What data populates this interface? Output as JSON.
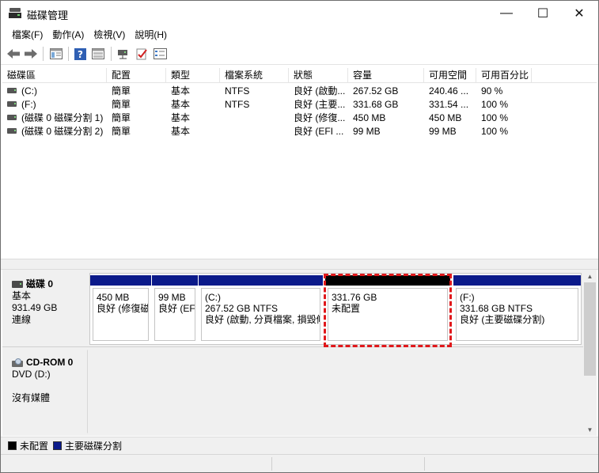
{
  "window": {
    "title": "磁碟管理",
    "minimize": "—",
    "maximize": "☐",
    "close": "✕"
  },
  "menu": [
    "檔案(F)",
    "動作(A)",
    "檢視(V)",
    "說明(H)"
  ],
  "toolbar": {
    "icons": [
      "back-arrow-icon",
      "forward-arrow-icon",
      "properties-grid-icon",
      "help-icon",
      "view-pane-icon",
      "connect-icon",
      "check-icon",
      "settings-list-icon"
    ]
  },
  "table": {
    "headers": [
      "磁碟區",
      "配置",
      "類型",
      "檔案系統",
      "狀態",
      "容量",
      "可用空間",
      "可用百分比"
    ],
    "rows": [
      [
        "(C:)",
        "簡單",
        "基本",
        "NTFS",
        "良好 (啟動...",
        "267.52 GB",
        "240.46 ...",
        "90 %"
      ],
      [
        "(F:)",
        "簡單",
        "基本",
        "NTFS",
        "良好 (主要...",
        "331.68 GB",
        "331.54 ...",
        "100 %"
      ],
      [
        "(磁碟 0 磁碟分割 1)",
        "簡單",
        "基本",
        "",
        "良好 (修復...",
        "450 MB",
        "450 MB",
        "100 %"
      ],
      [
        "(磁碟 0 磁碟分割 2)",
        "簡單",
        "基本",
        "",
        "良好 (EFI ...",
        "99 MB",
        "99 MB",
        "100 %"
      ]
    ]
  },
  "disk0": {
    "name": "磁碟 0",
    "type": "基本",
    "size": "931.49 GB",
    "status": "連線",
    "partitions": [
      {
        "line1": "",
        "line2": "450 MB",
        "line3": "良好 (修復磁",
        "bar": "primary"
      },
      {
        "line1": "",
        "line2": "99 MB",
        "line3": "良好 (EF",
        "bar": "primary"
      },
      {
        "line1": "(C:)",
        "line2": "267.52 GB NTFS",
        "line3": "良好 (啟動, 分頁檔案, 損毀傾",
        "bar": "primary"
      },
      {
        "line1": "",
        "line2": "331.76 GB",
        "line3": "未配置",
        "bar": "unallocated"
      },
      {
        "line1": "(F:)",
        "line2": "331.68 GB NTFS",
        "line3": "良好 (主要磁碟分割)",
        "bar": "primary"
      }
    ]
  },
  "cdrom0": {
    "name": "CD-ROM 0",
    "type": "DVD (D:)",
    "status": "沒有媒體"
  },
  "legend": {
    "unallocated": "未配置",
    "primary": "主要磁碟分割",
    "unallocated_color": "#000000",
    "primary_color": "#0b1a8a"
  },
  "colors": {
    "highlight": "#e0181b"
  }
}
